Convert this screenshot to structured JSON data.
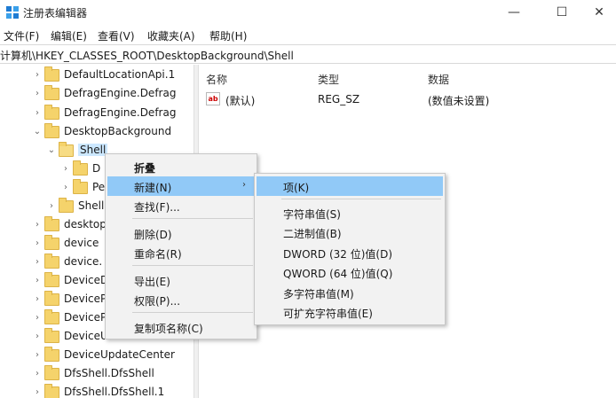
{
  "window": {
    "title": "注册表编辑器",
    "minimize": "—",
    "maximize": "☐",
    "close": "✕"
  },
  "menubar": {
    "items": [
      "文件(F)",
      "编辑(E)",
      "查看(V)",
      "收藏夹(A)",
      "帮助(H)"
    ]
  },
  "address": {
    "path": "计算机\\HKEY_CLASSES_ROOT\\DesktopBackground\\Shell"
  },
  "tree": {
    "rows": [
      {
        "label": "DefaultLocationApi.1",
        "chev": "›"
      },
      {
        "label": "DefragEngine.Defrag",
        "chev": "›"
      },
      {
        "label": "DefragEngine.Defrag",
        "chev": "›"
      },
      {
        "label": "DesktopBackground",
        "chev": "⌄"
      },
      {
        "label": "Shell",
        "chev": "⌄"
      },
      {
        "label": "D",
        "chev": "›"
      },
      {
        "label": "Pe",
        "chev": "›"
      },
      {
        "label": "Shell",
        "chev": "›"
      },
      {
        "label": "desktop",
        "chev": "›"
      },
      {
        "label": "device",
        "chev": "›"
      },
      {
        "label": "device.",
        "chev": "›"
      },
      {
        "label": "DeviceD",
        "chev": "›"
      },
      {
        "label": "DeviceP",
        "chev": "›"
      },
      {
        "label": "DeviceP",
        "chev": "›"
      },
      {
        "label": "DeviceU",
        "chev": "›"
      },
      {
        "label": "DeviceUpdateCenter",
        "chev": "›"
      },
      {
        "label": "DfsShell.DfsShell",
        "chev": "›"
      },
      {
        "label": "DfsShell.DfsShell.1",
        "chev": "›"
      }
    ]
  },
  "list": {
    "headers": {
      "name": "名称",
      "type": "类型",
      "data": "数据"
    },
    "rows": [
      {
        "icon": "ab",
        "name": "(默认)",
        "type": "REG_SZ",
        "data": "(数值未设置)"
      }
    ]
  },
  "context_menu": {
    "items": {
      "collapse": "折叠",
      "new": "新建(N)",
      "find": "查找(F)...",
      "delete": "删除(D)",
      "rename": "重命名(R)",
      "export": "导出(E)",
      "permissions": "权限(P)...",
      "copy_key_name": "复制项名称(C)"
    },
    "submenu_arrow": "›"
  },
  "new_submenu": {
    "items": {
      "key": "项(K)",
      "string": "字符串值(S)",
      "binary": "二进制值(B)",
      "dword": "DWORD (32 位)值(D)",
      "qword": "QWORD (64 位)值(Q)",
      "multi_string": "多字符串值(M)",
      "expandable_string": "可扩充字符串值(E)"
    }
  },
  "colors": {
    "highlight": "#91c9f7",
    "menu_bg": "#f2f2f2",
    "folder": "#f5d36b"
  }
}
